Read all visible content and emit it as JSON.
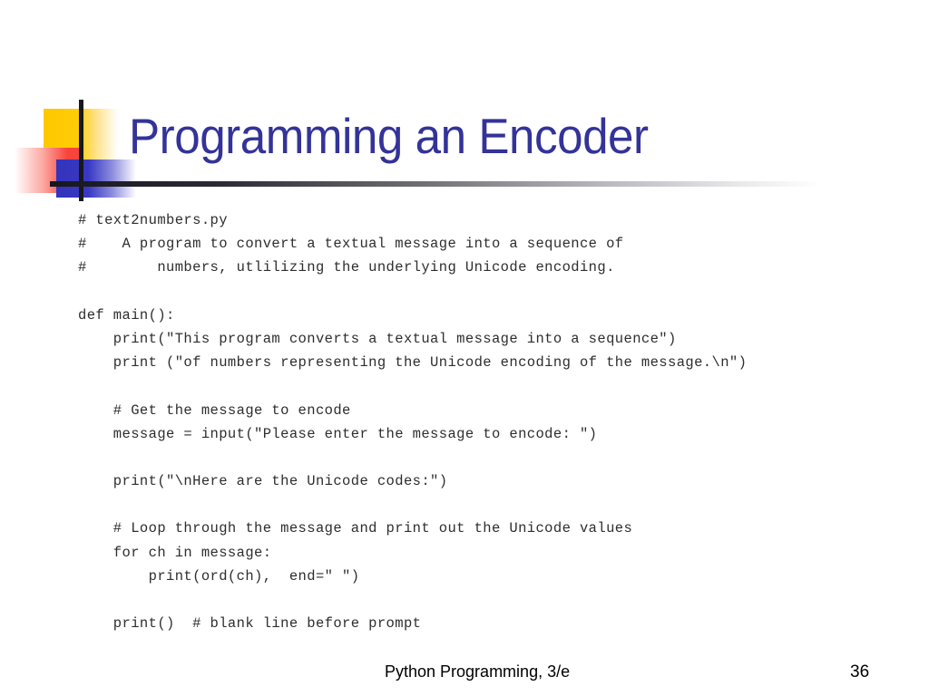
{
  "slide": {
    "title": "Programming an Encoder",
    "title_color": "#333399",
    "background_color": "#ffffff"
  },
  "decoration": {
    "yellow_color": "#FFCC00",
    "red_color": "#F8453C",
    "blue_color": "#3333BB",
    "bar_color": "#17171e"
  },
  "code": {
    "language": "python",
    "text_color": "#2e2e2e",
    "lines": [
      "# text2numbers.py",
      "#    A program to convert a textual message into a sequence of",
      "#        numbers, utlilizing the underlying Unicode encoding.",
      "",
      "def main():",
      "    print(\"This program converts a textual message into a sequence\")",
      "    print (\"of numbers representing the Unicode encoding of the message.\\n\")",
      "",
      "    # Get the message to encode",
      "    message = input(\"Please enter the message to encode: \")",
      "",
      "    print(\"\\nHere are the Unicode codes:\")",
      "",
      "    # Loop through the message and print out the Unicode values",
      "    for ch in message:",
      "        print(ord(ch),  end=\" \")",
      "",
      "    print()  # blank line before prompt"
    ]
  },
  "footer": {
    "title": "Python Programming, 3/e",
    "page_number": "36"
  }
}
